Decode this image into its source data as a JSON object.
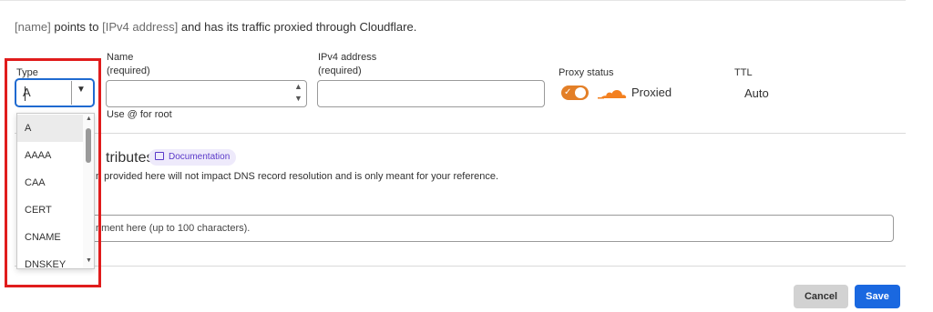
{
  "description": {
    "name_token": "[name]",
    "points_to": " points to ",
    "ip_token": "[IPv4 address]",
    "rest": " and has its traffic proxied through Cloudflare."
  },
  "fields": {
    "type": {
      "label": "Type",
      "value": "A"
    },
    "name": {
      "label": "Name",
      "sublabel": "(required)",
      "help": "Use @ for root",
      "value": ""
    },
    "ipv4": {
      "label": "IPv4 address",
      "sublabel": "(required)",
      "value": ""
    },
    "proxy": {
      "label": "Proxy status",
      "value": "Proxied",
      "enabled": true
    },
    "ttl": {
      "label": "TTL",
      "value": "Auto"
    }
  },
  "type_dropdown": {
    "options": [
      "A",
      "AAAA",
      "CAA",
      "CERT",
      "CNAME",
      "DNSKEY"
    ],
    "selected": "A"
  },
  "attributes": {
    "heading": "tributes",
    "doc_label": "Documentation",
    "note": "n provided here will not impact DNS record resolution and is only meant for your reference.",
    "comment_placeholder": "nment here (up to 100 characters)."
  },
  "actions": {
    "cancel": "Cancel",
    "save": "Save"
  },
  "icons": {
    "type_arrow": "chevron-down-icon",
    "cloud": "cloud-icon",
    "documentation": "book-icon"
  },
  "colors": {
    "accent": "#1a68e0",
    "proxy_orange": "#e37f27",
    "highlight": "#e01c1c",
    "badge_bg": "#eeeafb",
    "badge_text": "#5a39c9"
  }
}
